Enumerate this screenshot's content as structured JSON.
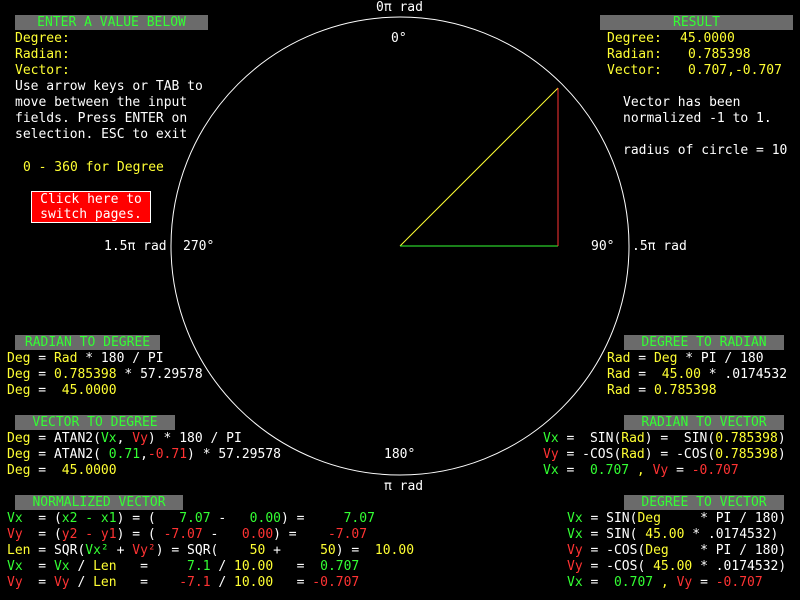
{
  "circle": {
    "top_label": "0π rad",
    "top_deg": "0°",
    "right_deg": "90°",
    "right_rad": ".5π rad",
    "left_rad": "1.5π rad",
    "left_deg": "270°",
    "bottom_deg": "180°",
    "bottom_label": "π rad",
    "colors": {
      "circle": "#ffffff",
      "hypotenuse": "#ffff33",
      "adjacent": "#33ff33",
      "opposite": "#ff3333"
    }
  },
  "enter_panel": {
    "title": "ENTER A VALUE BELOW",
    "degree_label": "Degree:",
    "radian_label": "Radian:",
    "vector_label": "Vector:",
    "help_lines": [
      "Use arrow keys or TAB to",
      "move between the input",
      "fields. Press ENTER on",
      "selection. ESC to exit"
    ],
    "range_hint": "0 - 360 for Degree",
    "button_line1": "Click here to",
    "button_line2": "switch pages."
  },
  "result_panel": {
    "title": "RESULT",
    "degree_label": "Degree:",
    "degree_value": "45.0000",
    "radian_label": "Radian:",
    "radian_value": "0.785398",
    "vector_label": "Vector:",
    "vector_value": "0.707,-0.707",
    "note_line1": "Vector has been",
    "note_line2": "normalized -1 to 1.",
    "radius_note": "radius of circle = 10"
  },
  "rad_to_deg": {
    "title": "RADIAN TO DEGREE",
    "l1": {
      "a": "Deg",
      "b": " = ",
      "c": "Rad",
      "d": " * 180 / PI"
    },
    "l2": {
      "a": "Deg",
      "b": " = ",
      "c": "0.785398",
      "d": " * 57.29578"
    },
    "l3": {
      "a": "Deg",
      "b": " = ",
      "c": " 45.0000"
    }
  },
  "deg_to_rad": {
    "title": "DEGREE TO RADIAN",
    "l1": {
      "a": "Rad",
      "b": " = ",
      "c": "Deg",
      "d": " * PI / 180"
    },
    "l2": {
      "a": "Rad",
      "b": " = ",
      "c": " 45.00",
      "d": " * .0174532"
    },
    "l3": {
      "a": "Rad",
      "b": " = ",
      "c": "0.785398"
    }
  },
  "vec_to_deg": {
    "title": "VECTOR TO DEGREE",
    "l1": {
      "a": "Deg",
      "b": " = ATAN2(",
      "c": "Vx",
      "d": ", ",
      "e": "Vy",
      "f": ") * 180 / PI"
    },
    "l2": {
      "a": "Deg",
      "b": " = ATAN2( ",
      "c": "0.71",
      "d": ",",
      "e": "-0.71",
      "f": ") * 57.29578"
    },
    "l3": {
      "a": "Deg",
      "b": " = ",
      "c": " 45.0000"
    }
  },
  "rad_to_vec": {
    "title": "RADIAN TO VECTOR",
    "l1": {
      "a": "Vx",
      "b": " =  SIN(",
      "c": "Rad",
      "d": ") =  SIN(",
      "e": "0.785398",
      "f": ")"
    },
    "l2": {
      "a": "Vy",
      "b": " = -COS(",
      "c": "Rad",
      "d": ") = -COS(",
      "e": "0.785398",
      "f": ")"
    },
    "l3": {
      "a": "Vx",
      "b": " =  ",
      "c": "0.707",
      "d": " , ",
      "e": "Vy",
      "f": " = ",
      "g": "-0.707"
    }
  },
  "normalized": {
    "title": "NORMALIZED VECTOR",
    "l1": {
      "a": "Vx",
      "b": "  = (",
      "c": "x2 - x1",
      "d": ") = (  ",
      "e": " 7.07",
      "f": " -   ",
      "g": "0.00",
      "h": ") =    ",
      "i": " 7.07"
    },
    "l2": {
      "a": "Vy",
      "b": "  = (",
      "c": "y2 - y1",
      "d": ") = ( ",
      "e": "-7.07",
      "f": " -   ",
      "g": "0.00",
      "h": ") =    ",
      "i": "-7.07"
    },
    "l3": {
      "a": "Len",
      "b": " = SQR(",
      "c": "Vx²",
      "d": " + ",
      "e": "Vy²",
      "f": ") = SQR(    ",
      "g": "50",
      "h": " +     ",
      "i": "50",
      "j": ") =  ",
      "k": "10.00"
    },
    "l4": {
      "a": "Vx",
      "b": "  = ",
      "c": "Vx",
      "d": " / ",
      "e": "Len",
      "f": "   =   ",
      "g": "  7.1",
      "h": " / ",
      "i": "10.00",
      "j": "   = ",
      "k": " 0.707"
    },
    "l5": {
      "a": "Vy",
      "b": "  = ",
      "c": "Vy",
      "d": " / ",
      "e": "Len",
      "f": "   =   ",
      "g": " -7.1",
      "h": " / ",
      "i": "10.00",
      "j": "   = ",
      "k": "-0.707"
    }
  },
  "deg_to_vec": {
    "title": "DEGREE TO VECTOR",
    "l1": {
      "a": "Vx",
      "b": " = SIN(",
      "c": "Deg",
      "d": "     * PI / 180)"
    },
    "l2": {
      "a": "Vx",
      "b": " = SIN( ",
      "c": "45.00",
      "d": " * .0174532)"
    },
    "l3": {
      "a": "Vy",
      "b": " = -COS(",
      "c": "Deg",
      "d": "    * PI / 180)"
    },
    "l4": {
      "a": "Vy",
      "b": " = -COS( ",
      "c": "45.00",
      "d": " * .0174532)"
    },
    "l5": {
      "a": "Vx",
      "b": " =  ",
      "c": "0.707",
      "d": " , ",
      "e": "Vy",
      "f": " = ",
      "g": "-0.707"
    }
  }
}
